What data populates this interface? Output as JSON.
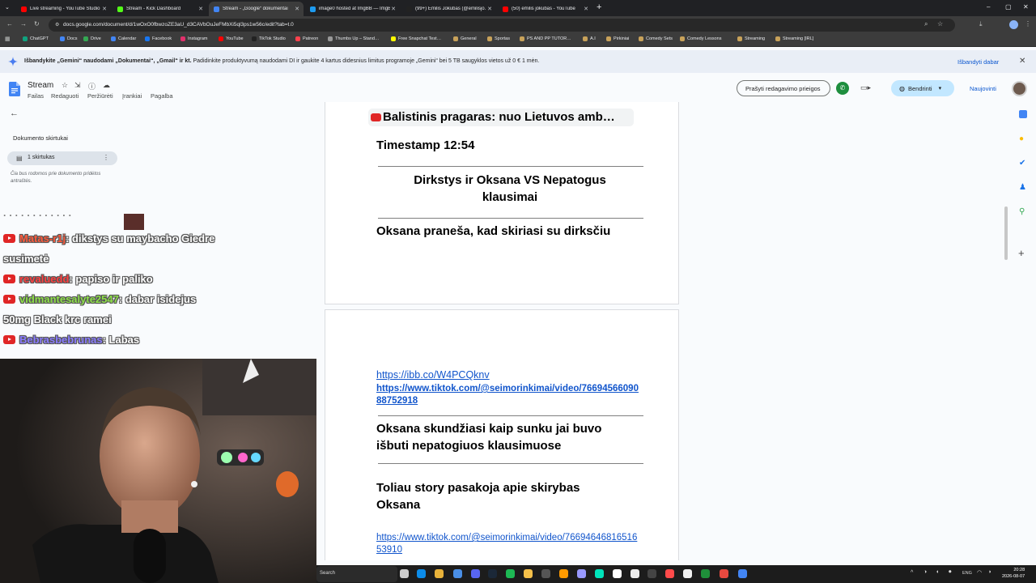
{
  "browser": {
    "tabs": [
      {
        "title": "Live streaming - YouTube Studio",
        "color": "#ff0000"
      },
      {
        "title": "Stream - Kick Dashboard",
        "color": "#53fc18"
      },
      {
        "title": "Stream - „Google“ dokumentai",
        "color": "#4285f4",
        "active": true
      },
      {
        "title": "image0 hosted at ImgBB — ImgBB",
        "color": "#1d9bf0"
      },
      {
        "title": "(99+) Emilis Jokūbas (@emilisjo…",
        "color": "#222222"
      },
      {
        "title": "(50) emilis jokubas - YouTube",
        "color": "#ff0000"
      }
    ],
    "url": "docs.google.com/document/d/1wOxO0fbwzoZE3aU_d3CAVbOuJeFMbXi5ql3ps1w56c/edit?tab=t.0",
    "bookmarks": [
      "ChatGPT",
      "Docs",
      "Drive",
      "Calendar",
      "Facebook",
      "Instagram",
      "YouTube",
      "TikTok Studio",
      "Patreon",
      "Thumbs Up – Stand…",
      "Free Snapchat Test…",
      "General",
      "Sportas",
      "PS AND PP TUTOR…",
      "A.I",
      "Pirkiniai",
      "Comedy Sets",
      "Comedy Lessons",
      "Streaming",
      "Streaming [IRL]"
    ]
  },
  "banner": {
    "bold_text": "Išbandykite „Gemini“ naudodami „Dokumentai“, „Gmail“ ir kt.",
    "text": " Padidinkite produktyvumą naudodami DI ir gaukite 4 kartus didesnius limitus programoje „Gemini“ bei 5 TB saugyklos vietos už 0 € 1 mėn.",
    "cta": "Išbandyti dabar"
  },
  "docs": {
    "title": "Stream",
    "menu": [
      "Failas",
      "Redaguoti",
      "Peržiūrėti",
      "Įrankiai",
      "Pagalba"
    ],
    "request_edit": "Prašyti redagavimo prieigos",
    "share": "Bendrinti",
    "refresh": "Naujovinti"
  },
  "outline": {
    "title": "Dokumento skirtukai",
    "tab_label": "1 skirtukas",
    "hint": "Čia bus rodomos prie dokumento pridėtos antraštės."
  },
  "chat": [
    {
      "user": "Matas-r1j",
      "msg": "dikstys su maybacho Giedre",
      "color": "#ff5a3c"
    },
    {
      "user": "",
      "msg": "susimetė",
      "color": "#ffffff"
    },
    {
      "user": "revaluedd",
      "msg": "papiso ir paliko",
      "color": "#ff4040"
    },
    {
      "user": "vidmantesalyte2547",
      "msg": "dabar isidejus",
      "color": "#8ee04a"
    },
    {
      "user": "",
      "msg": "50mg Black krc ramei",
      "color": "#ffffff"
    },
    {
      "user": "Bebrasbebrunas",
      "msg": "Labas",
      "color": "#8a7cff"
    }
  ],
  "document": {
    "chip": "Balistinis pragaras: nuo Lietuvos amb…",
    "timestamp": "Timestamp 12:54",
    "heading1_line1": "Dirkstys ir Oksana VS Nepatogus",
    "heading1_line2": "klausimai",
    "para1": "Oksana praneša, kad skiriasi su dirksčiu",
    "link1": "https://ibb.co/W4PCQknv",
    "link2_line1": "https://www.tiktok.com/@seimorinkimai/video/76694566090",
    "link2_line2": "88752918",
    "para2_line1": "Oksana skundžiasi kaip sunku jai buvo",
    "para2_line2": "išbuti nepatogiuos klausimuose",
    "para3_line1": "Toliau story pasakoja apie skirybas",
    "para3_line2": "Oksana",
    "link3_line1": "https://www.tiktok.com/@seimorinkimai/video/76694646816516",
    "link3_line2": "53910"
  },
  "taskbar": {
    "search": "Search",
    "lang": "ENG",
    "time": "20:28",
    "date": "2026-08-07"
  }
}
